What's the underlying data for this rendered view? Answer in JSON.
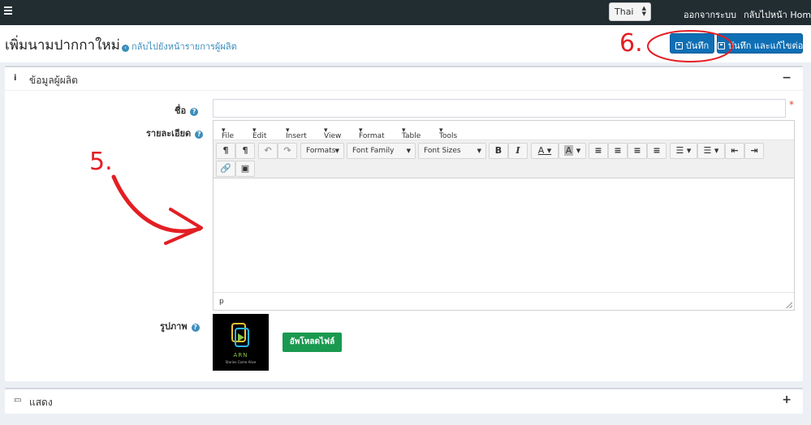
{
  "topbar": {
    "language": "Thai",
    "logout": "ออกจากระบบ",
    "home": "กลับไปหน้า Home"
  },
  "header": {
    "title": "เพิ่มนามปากกาใหม่",
    "back_link": "กลับไปยังหน้ารายการผู้ผลิต",
    "save": "บันทึก",
    "save_continue": "บันทึก และแก้ไขต่อ"
  },
  "panel_info": {
    "title": "ข้อมูลผู้ผลิต",
    "toggle": "−",
    "fields": {
      "name_label": "ชื่อ",
      "name_value": "",
      "required_mark": "*",
      "detail_label": "รายละเอียด",
      "image_label": "รูปภาพ",
      "upload_button": "อัพโหลดไฟล์"
    }
  },
  "editor": {
    "menu": [
      "File",
      "Edit",
      "Insert",
      "View",
      "Format",
      "Table",
      "Tools"
    ],
    "formats": "Formats",
    "font_family": "Font Family",
    "font_sizes": "Font Sizes",
    "status_path": "p"
  },
  "thumbnail": {
    "brand": "ARN",
    "tagline": "Stories Come Alive"
  },
  "panel_display": {
    "title": "แสดง",
    "toggle": "+"
  },
  "annotations": {
    "step5": "5.",
    "step6": "6."
  },
  "colors": {
    "topbar": "#222d32",
    "primary": "#0f6fb5",
    "success": "#1a9950",
    "annotation": "#e31e24",
    "link": "#3c8dbc"
  }
}
